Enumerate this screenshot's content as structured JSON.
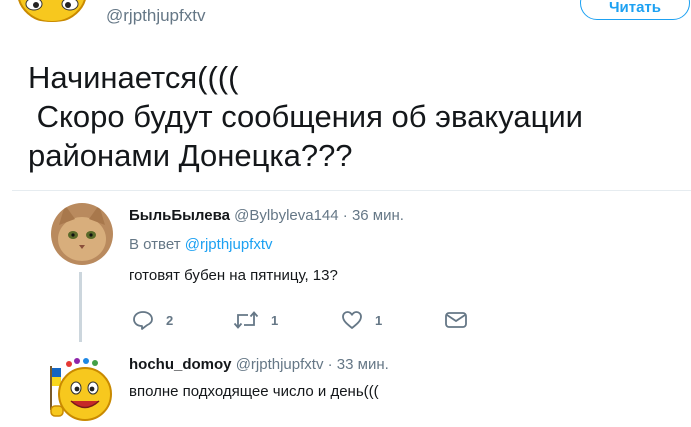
{
  "top": {
    "handle": "@rjpthjupfxtv",
    "follow_label": "Читать"
  },
  "tweet": {
    "text": "Начинается((((\n Скоро будут сообщения об эвакуации\nрайонами Донецка???"
  },
  "replies": [
    {
      "name": "БыльБылева",
      "handle": "@Bylbyleva144",
      "time": "· 36 мин.",
      "reply_to_prefix": "В ответ",
      "reply_to_handle": "@rjpthjupfxtv",
      "text": "готовят бубен на пятницу, 13?",
      "actions": {
        "reply_count": "2",
        "retweet_count": "1",
        "like_count": "1"
      }
    },
    {
      "name": "hochu_domoy",
      "handle": "@rjpthjupfxtv",
      "time": "· 33 мин.",
      "text": "вполне подходящее число и день((("
    }
  ],
  "colors": {
    "accent": "#1da1f2",
    "muted": "#657786",
    "text": "#14171a",
    "divider": "#e6ecf0"
  },
  "icons": [
    "smiley-avatar-icon",
    "reply-icon",
    "retweet-icon",
    "like-icon",
    "direct-message-icon"
  ]
}
